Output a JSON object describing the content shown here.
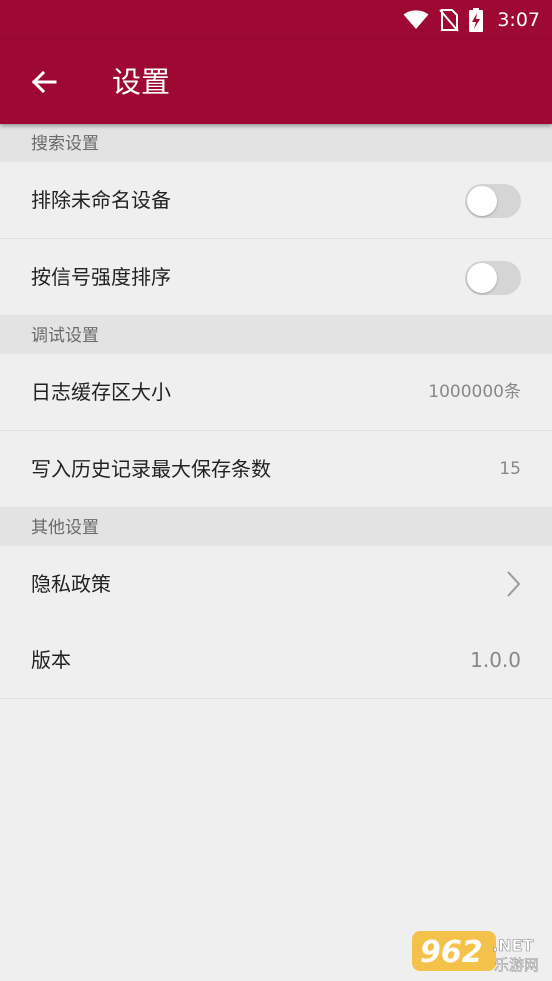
{
  "status_bar": {
    "time": "3:07",
    "icons": [
      "wifi-icon",
      "no-sim-icon",
      "battery-charging-icon"
    ]
  },
  "app_bar": {
    "back_icon": "arrow-left-icon",
    "title": "设置"
  },
  "sections": [
    {
      "header": "搜索设置",
      "rows": [
        {
          "label": "排除未命名设备",
          "type": "toggle",
          "on": false
        },
        {
          "label": "按信号强度排序",
          "type": "toggle",
          "on": false
        }
      ]
    },
    {
      "header": "调试设置",
      "rows": [
        {
          "label": "日志缓存区大小",
          "type": "value",
          "value": "1000000条"
        },
        {
          "label": "写入历史记录最大保存条数",
          "type": "value",
          "value": "15"
        }
      ]
    },
    {
      "header": "其他设置",
      "rows": [
        {
          "label": "隐私政策",
          "type": "link",
          "icon": "chevron-right-icon"
        },
        {
          "label": "版本",
          "type": "value",
          "value": "1.0.0"
        }
      ]
    }
  ],
  "watermark": {
    "brand": "962",
    "suffix": ".NET",
    "sub": "乐游网"
  },
  "colors": {
    "primary": "#9e0933",
    "background": "#efefef",
    "section_header_bg": "#e3e3e3",
    "toggle_off": "#d5d5d5"
  }
}
